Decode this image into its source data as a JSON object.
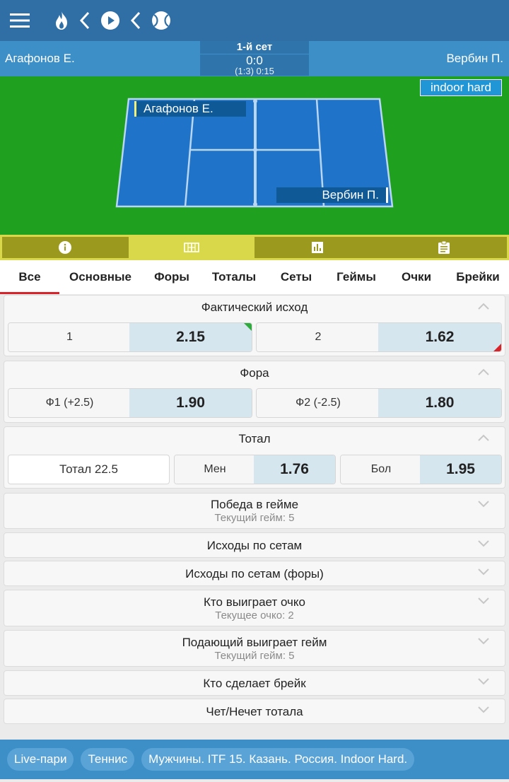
{
  "header": {
    "icons": [
      "menu-icon",
      "fire-icon",
      "back-icon",
      "play-icon",
      "back-icon",
      "tennis-ball-icon"
    ]
  },
  "match": {
    "player1": "Агафонов Е.",
    "player2": "Вербин П.",
    "set_label": "1-й сет",
    "score": "0:0",
    "game_time": "(1:3) 0:15"
  },
  "court": {
    "surface": "indoor hard",
    "player_top": "Агафонов Е.",
    "player_bottom": "Вербин П.",
    "colors": {
      "grass": "#1fa01f",
      "court": "#1f74c9"
    }
  },
  "info_tabs": [
    {
      "icon": "info-icon"
    },
    {
      "icon": "court-icon",
      "active": true
    },
    {
      "icon": "stats-icon"
    },
    {
      "icon": "clipboard-icon"
    }
  ],
  "market_tabs": [
    "Все",
    "Основные",
    "Форы",
    "Тоталы",
    "Сеты",
    "Геймы",
    "Очки",
    "Брейки"
  ],
  "markets": {
    "outcome": {
      "title": "Фактический исход",
      "opt1_label": "1",
      "opt1_value": "2.15",
      "opt2_label": "2",
      "opt2_value": "1.62"
    },
    "handicap": {
      "title": "Фора",
      "opt1_label": "Ф1 (+2.5)",
      "opt1_value": "1.90",
      "opt2_label": "Ф2 (-2.5)",
      "opt2_value": "1.80"
    },
    "total": {
      "title": "Тотал",
      "line": "Тотал 22.5",
      "under_label": "Мен",
      "under_value": "1.76",
      "over_label": "Бол",
      "over_value": "1.95"
    },
    "collapsed": [
      {
        "title": "Победа в гейме",
        "sub": "Текущий гейм: 5"
      },
      {
        "title": "Исходы по сетам"
      },
      {
        "title": "Исходы по сетам (форы)"
      },
      {
        "title": "Кто выиграет очко",
        "sub": "Текущее очко: 2"
      },
      {
        "title": "Подающий выиграет гейм",
        "sub": "Текущий гейм: 5"
      },
      {
        "title": "Кто сделает брейк"
      },
      {
        "title": "Чет/Нечет тотала"
      }
    ]
  },
  "breadcrumbs": [
    "Live-пари",
    "Теннис",
    "Мужчины. ITF 15. Казань. Россия. Indoor Hard."
  ]
}
